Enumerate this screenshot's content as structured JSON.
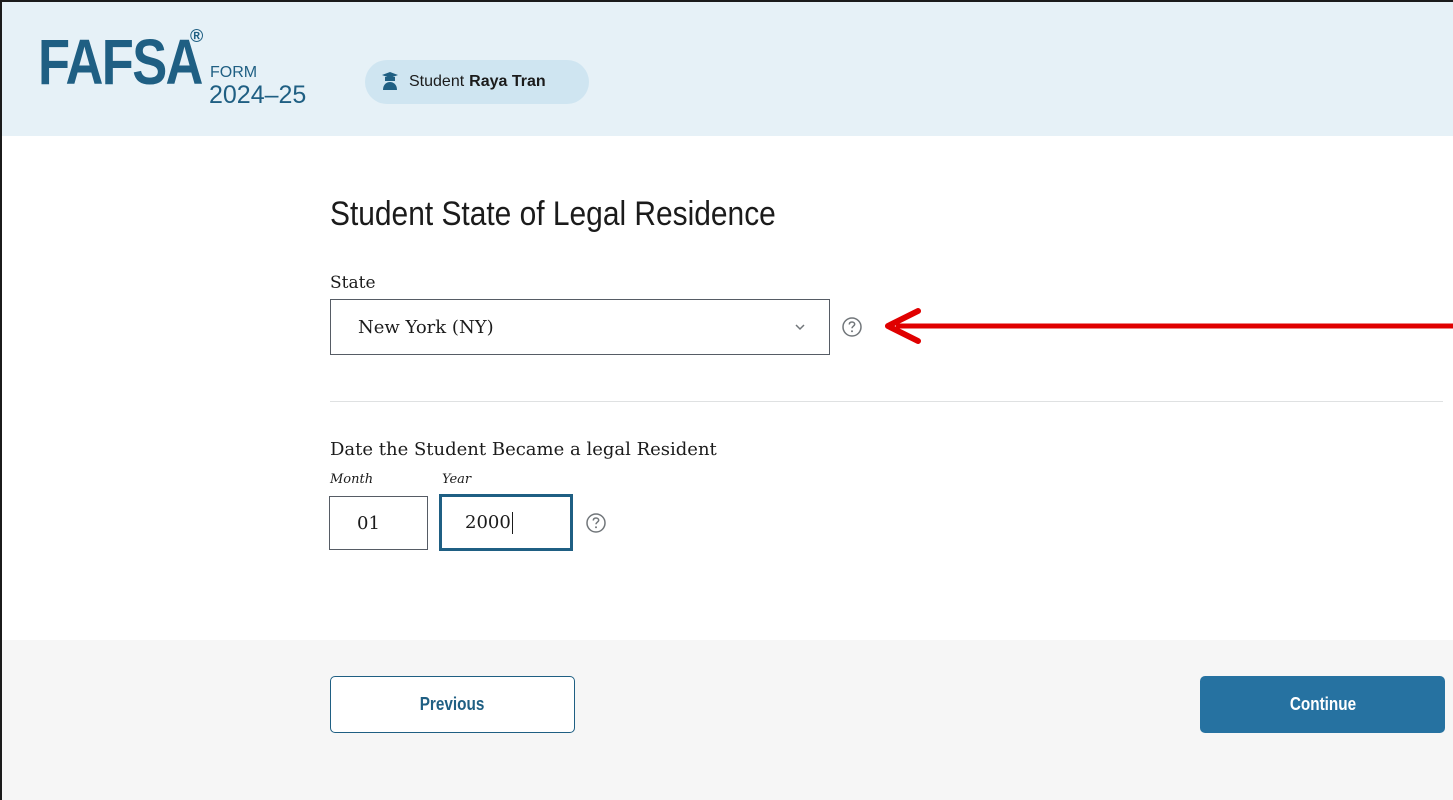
{
  "header": {
    "logo_text": "FAFSA",
    "logo_mark": "®",
    "form_label": "FORM",
    "form_year": "2024–25",
    "badge": {
      "role": "Student",
      "name": "Raya Tran",
      "icon": "student-icon"
    }
  },
  "main": {
    "title": "Student State of Legal Residence",
    "state": {
      "label": "State",
      "value": "New York (NY)",
      "help_icon": "help-circle-icon"
    },
    "date": {
      "label": "Date the Student Became a legal Resident",
      "month_hint": "Month",
      "year_hint": "Year",
      "month_value": "01",
      "year_value": "2000",
      "help_icon": "help-circle-icon"
    }
  },
  "footer": {
    "previous_label": "Previous",
    "continue_label": "Continue"
  },
  "annotation": {
    "arrow_color": "#e00000"
  },
  "colors": {
    "brand": "#1f5f83",
    "accent_button": "#2672a1",
    "header_bg": "#e6f1f7"
  }
}
